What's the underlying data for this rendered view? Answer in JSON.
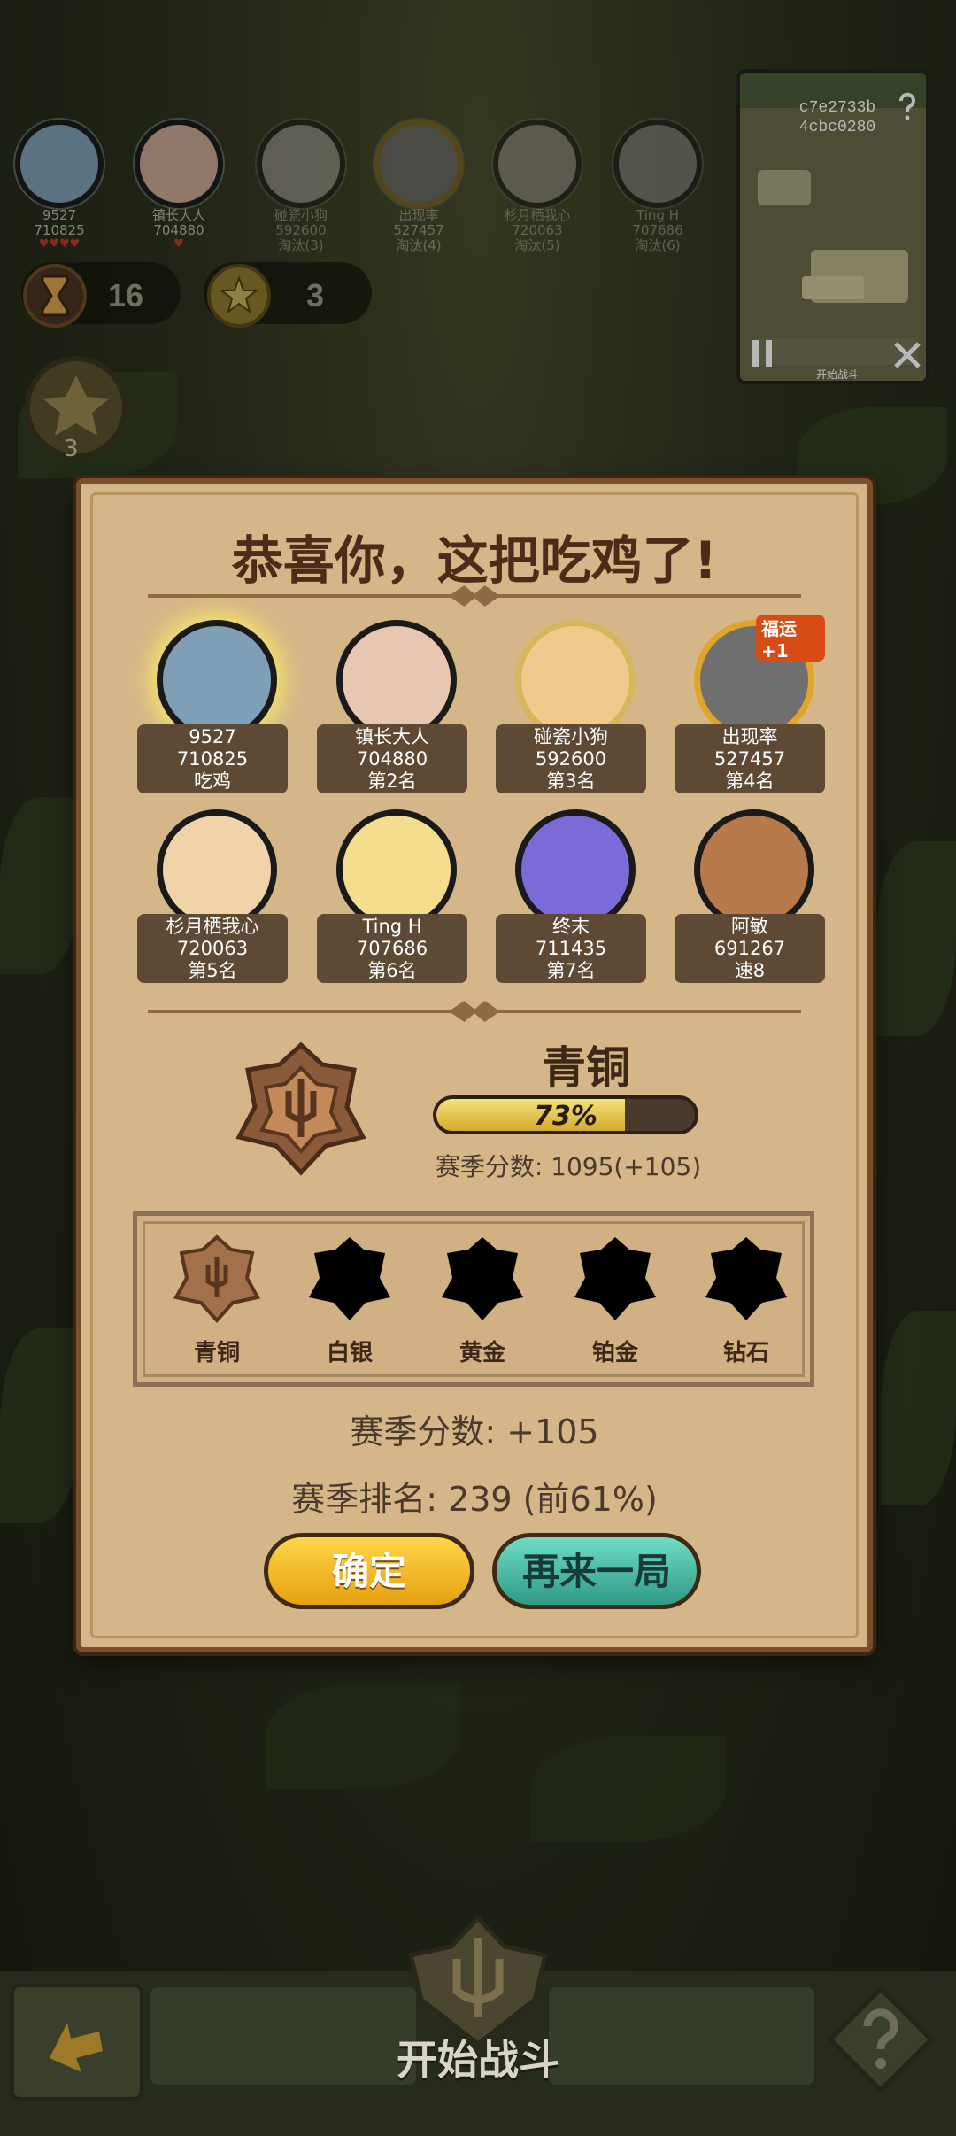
{
  "top_players": [
    {
      "name": "9527",
      "score": "710825",
      "status": ""
    },
    {
      "name": "镇长大人",
      "score": "704880",
      "status": ""
    },
    {
      "name": "碰瓷小狗",
      "score": "592600",
      "status": "淘汰(3)"
    },
    {
      "name": "出现率",
      "score": "527457",
      "status": "淘汰(4)"
    },
    {
      "name": "杉月栖我心",
      "score": "720063",
      "status": "淘汰(5)"
    },
    {
      "name": "Ting H",
      "score": "707686",
      "status": "淘汰(6)"
    }
  ],
  "stats": {
    "turns": "16",
    "coins": "3",
    "level": "3"
  },
  "minimap": {
    "line1": "c7e2733b",
    "line2": "4cbc0280",
    "button": "开始战斗"
  },
  "dialog": {
    "title": "恭喜你，这把吃鸡了!",
    "players": [
      {
        "name": "9527",
        "score": "710825",
        "rank": "吃鸡",
        "avatar_color": "#7f9fb6"
      },
      {
        "name": "镇长大人",
        "score": "704880",
        "rank": "第2名",
        "avatar_color": "#e7c7b2"
      },
      {
        "name": "碰瓷小狗",
        "score": "592600",
        "rank": "第3名",
        "avatar_color": "#f2c98d"
      },
      {
        "name": "出现率",
        "score": "527457",
        "rank": "第4名",
        "avatar_color": "#6f6f6f",
        "badge": "福运+1"
      },
      {
        "name": "杉月栖我心",
        "score": "720063",
        "rank": "第5名",
        "avatar_color": "#f0d3a8"
      },
      {
        "name": "Ting H",
        "score": "707686",
        "rank": "第6名",
        "avatar_color": "#f4dd8c"
      },
      {
        "name": "终末",
        "score": "711435",
        "rank": "第7名",
        "avatar_color": "#7a6bd8"
      },
      {
        "name": "阿敏",
        "score": "691267",
        "rank": "速8",
        "avatar_color": "#b77a4a"
      }
    ],
    "tier": {
      "name": "青铜",
      "progress": 0.73,
      "progress_label": "73%",
      "season_score": "赛季分数: 1095(+105)"
    },
    "tiers": [
      "青铜",
      "白银",
      "黄金",
      "铂金",
      "钻石"
    ],
    "season_delta": "赛季分数: +105",
    "season_rank": "赛季排名: 239 (前61%)",
    "confirm": "确定",
    "again": "再来一局"
  },
  "bottom": {
    "start": "开始战斗"
  }
}
